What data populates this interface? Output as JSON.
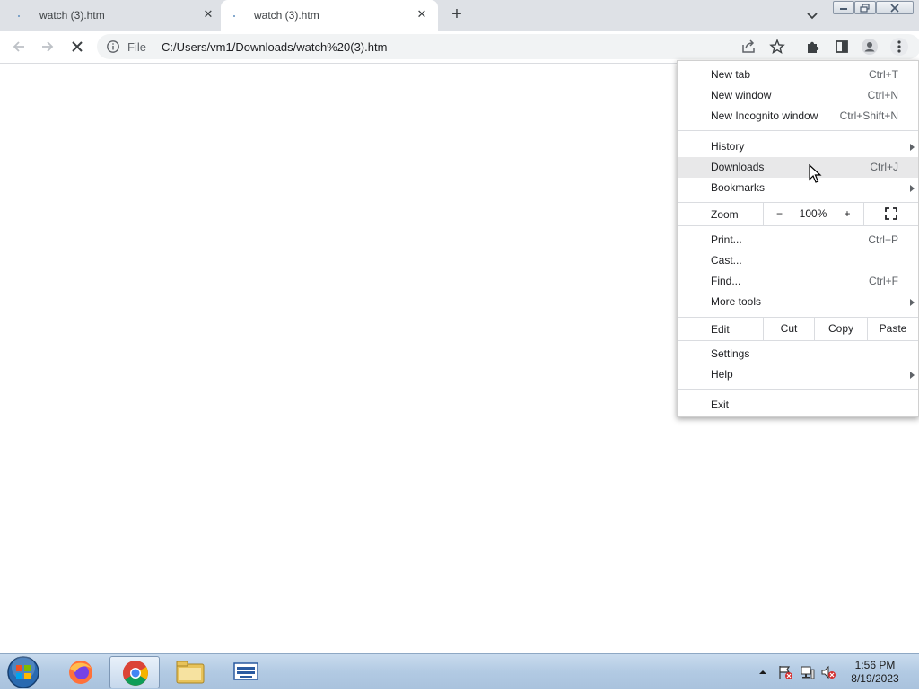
{
  "tabs": [
    {
      "title": "watch (3).htm",
      "active": false
    },
    {
      "title": "watch (3).htm",
      "active": true
    }
  ],
  "toolbar": {
    "scheme": "File",
    "url": "C:/Users/vm1/Downloads/watch%20(3).htm"
  },
  "menu": {
    "new_tab": {
      "label": "New tab",
      "shortcut": "Ctrl+T"
    },
    "new_window": {
      "label": "New window",
      "shortcut": "Ctrl+N"
    },
    "new_incognito": {
      "label": "New Incognito window",
      "shortcut": "Ctrl+Shift+N"
    },
    "history": {
      "label": "History"
    },
    "downloads": {
      "label": "Downloads",
      "shortcut": "Ctrl+J"
    },
    "bookmarks": {
      "label": "Bookmarks"
    },
    "zoom": {
      "label": "Zoom",
      "minus": "−",
      "level": "100%",
      "plus": "+"
    },
    "print": {
      "label": "Print...",
      "shortcut": "Ctrl+P"
    },
    "cast": {
      "label": "Cast..."
    },
    "find": {
      "label": "Find...",
      "shortcut": "Ctrl+F"
    },
    "more_tools": {
      "label": "More tools"
    },
    "edit": {
      "label": "Edit",
      "cut": "Cut",
      "copy": "Copy",
      "paste": "Paste"
    },
    "settings": {
      "label": "Settings"
    },
    "help": {
      "label": "Help"
    },
    "exit": {
      "label": "Exit"
    }
  },
  "taskbar": {
    "time": "1:56 PM",
    "date": "8/19/2023"
  },
  "colors": {
    "tabstrip": "#dee1e6",
    "highlight": "#e8e8e9",
    "taskbar": "#b2cae3"
  }
}
